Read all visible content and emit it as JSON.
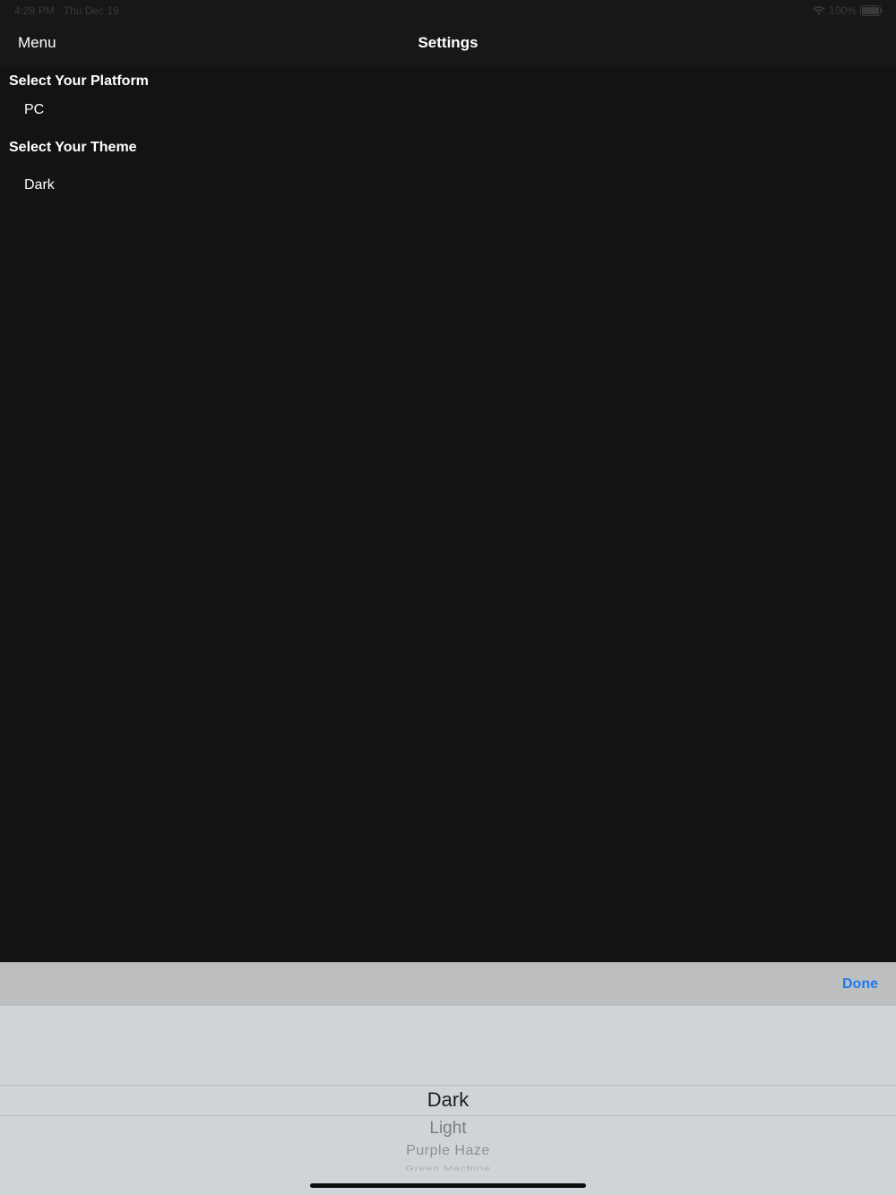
{
  "status_bar": {
    "time": "4:28 PM",
    "date": "Thu Dec 19",
    "battery": "100%"
  },
  "nav": {
    "menu_label": "Menu",
    "title": "Settings"
  },
  "settings": {
    "platform_label": "Select Your Platform",
    "platform_value": "PC",
    "theme_label": "Select Your Theme",
    "theme_value": "Dark"
  },
  "picker": {
    "done_label": "Done",
    "options": [
      "Dark",
      "Light",
      "Purple Haze",
      "Green Machine"
    ],
    "selected": "Dark"
  },
  "colors": {
    "background": "#131314",
    "accent": "#1c7cf3",
    "picker_background": "#d0d3d8"
  }
}
